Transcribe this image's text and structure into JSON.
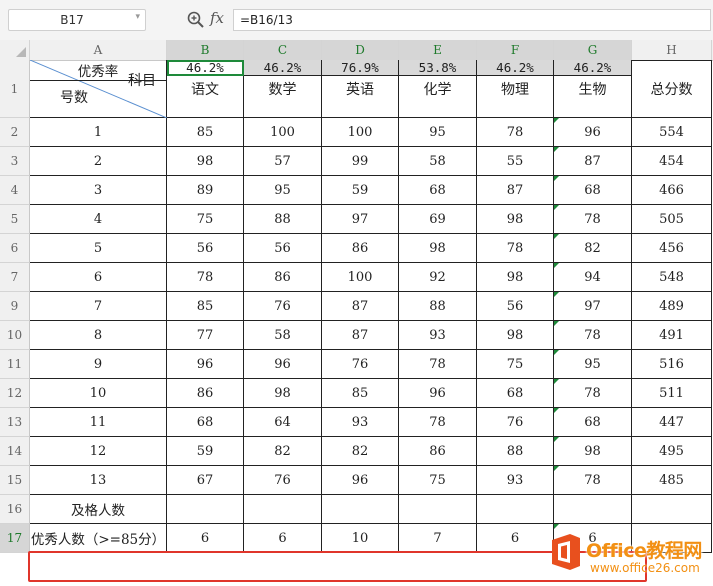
{
  "formula_bar": {
    "name_box": "B17",
    "zoom_icon": "zoom-icon",
    "fx_label": "fx",
    "formula": "=B16/13"
  },
  "column_headers": [
    "A",
    "B",
    "C",
    "D",
    "E",
    "F",
    "G",
    "H"
  ],
  "selected_column_headers": [
    "B",
    "C",
    "D",
    "E",
    "F",
    "G"
  ],
  "row_numbers": [
    "1",
    "2",
    "3",
    "4",
    "5",
    "6",
    "7",
    "9",
    "10",
    "11",
    "12",
    "13",
    "14",
    "15",
    "16",
    "17"
  ],
  "selected_row_number": "17",
  "diagonal_header": {
    "top_right": "科目",
    "bottom_left": "号数"
  },
  "subject_headers": [
    "语文",
    "数学",
    "英语",
    "化学",
    "物理",
    "生物",
    "总分数"
  ],
  "data_rows": [
    {
      "no": "1",
      "scores": [
        "85",
        "100",
        "100",
        "95",
        "78",
        "96"
      ],
      "total": "554"
    },
    {
      "no": "2",
      "scores": [
        "98",
        "57",
        "99",
        "58",
        "55",
        "87"
      ],
      "total": "454"
    },
    {
      "no": "3",
      "scores": [
        "89",
        "95",
        "59",
        "68",
        "87",
        "68"
      ],
      "total": "466"
    },
    {
      "no": "4",
      "scores": [
        "75",
        "88",
        "97",
        "69",
        "98",
        "78"
      ],
      "total": "505"
    },
    {
      "no": "5",
      "scores": [
        "56",
        "56",
        "86",
        "98",
        "78",
        "82"
      ],
      "total": "456"
    },
    {
      "no": "6",
      "scores": [
        "78",
        "86",
        "100",
        "92",
        "98",
        "94"
      ],
      "total": "548"
    },
    {
      "no": "7",
      "scores": [
        "85",
        "76",
        "87",
        "88",
        "56",
        "97"
      ],
      "total": "489"
    },
    {
      "no": "8",
      "scores": [
        "77",
        "58",
        "87",
        "93",
        "98",
        "78"
      ],
      "total": "491"
    },
    {
      "no": "9",
      "scores": [
        "96",
        "96",
        "76",
        "78",
        "75",
        "95"
      ],
      "total": "516"
    },
    {
      "no": "10",
      "scores": [
        "86",
        "98",
        "85",
        "96",
        "68",
        "78"
      ],
      "total": "511"
    },
    {
      "no": "11",
      "scores": [
        "68",
        "64",
        "93",
        "78",
        "76",
        "68"
      ],
      "total": "447"
    },
    {
      "no": "12",
      "scores": [
        "59",
        "82",
        "82",
        "86",
        "88",
        "98"
      ],
      "total": "495"
    },
    {
      "no": "13",
      "scores": [
        "67",
        "76",
        "96",
        "75",
        "93",
        "78"
      ],
      "total": "485"
    }
  ],
  "summary_rows": [
    {
      "label": "及格人数",
      "values": [
        "",
        "",
        "",
        "",
        "",
        "",
        ""
      ]
    },
    {
      "label": "优秀人数（>=85分）",
      "values": [
        "6",
        "6",
        "10",
        "7",
        "6",
        "6",
        ""
      ]
    },
    {
      "label": "优秀率",
      "values": [
        "46.2%",
        "46.2%",
        "76.9%",
        "53.8%",
        "46.2%",
        "46.2%",
        ""
      ]
    }
  ],
  "watermark": {
    "brand": "Office教程网",
    "url": "www.office26.com"
  },
  "colors": {
    "selection_green": "#1e8a3a",
    "highlight_red": "#e0352b",
    "watermark_orange": "#f29014"
  }
}
